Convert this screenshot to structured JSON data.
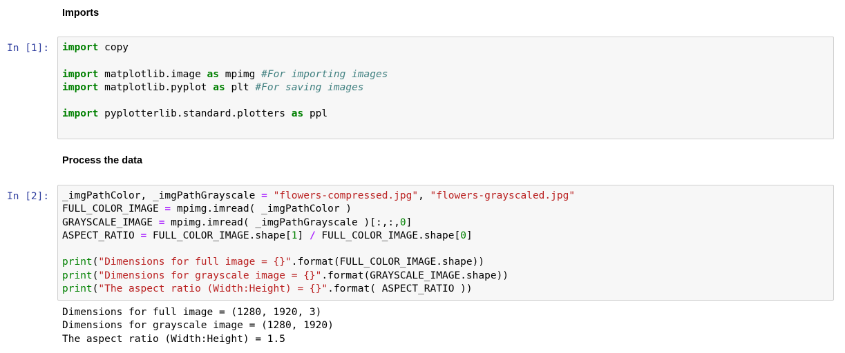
{
  "cells": [
    {
      "type": "markdown",
      "text": "Imports"
    },
    {
      "type": "code",
      "prompt": "In [1]:",
      "lines": [
        [
          {
            "t": "kw",
            "v": "import"
          },
          {
            "t": "",
            "v": " copy"
          }
        ],
        [],
        [
          {
            "t": "kw",
            "v": "import"
          },
          {
            "t": "",
            "v": " matplotlib.image "
          },
          {
            "t": "kw",
            "v": "as"
          },
          {
            "t": "",
            "v": " mpimg "
          },
          {
            "t": "cm",
            "v": "#For importing images"
          }
        ],
        [
          {
            "t": "kw",
            "v": "import"
          },
          {
            "t": "",
            "v": " matplotlib.pyplot "
          },
          {
            "t": "kw",
            "v": "as"
          },
          {
            "t": "",
            "v": " plt "
          },
          {
            "t": "cm",
            "v": "#For saving images"
          }
        ],
        [],
        [
          {
            "t": "kw",
            "v": "import"
          },
          {
            "t": "",
            "v": " pyplotterlib.standard.plotters "
          },
          {
            "t": "kw",
            "v": "as"
          },
          {
            "t": "",
            "v": " ppl"
          }
        ]
      ]
    },
    {
      "type": "markdown",
      "text": "Process the data"
    },
    {
      "type": "code",
      "prompt": "In [2]:",
      "lines": [
        [
          {
            "t": "",
            "v": "_imgPathColor, _imgPathGrayscale "
          },
          {
            "t": "op",
            "v": "="
          },
          {
            "t": "",
            "v": " "
          },
          {
            "t": "str",
            "v": "\"flowers-compressed.jpg\""
          },
          {
            "t": "",
            "v": ", "
          },
          {
            "t": "str",
            "v": "\"flowers-grayscaled.jpg\""
          }
        ],
        [
          {
            "t": "",
            "v": "FULL_COLOR_IMAGE "
          },
          {
            "t": "op",
            "v": "="
          },
          {
            "t": "",
            "v": " mpimg.imread( _imgPathColor )"
          }
        ],
        [
          {
            "t": "",
            "v": "GRAYSCALE_IMAGE "
          },
          {
            "t": "op",
            "v": "="
          },
          {
            "t": "",
            "v": " mpimg.imread( _imgPathGrayscale )[:,:,"
          },
          {
            "t": "num",
            "v": "0"
          },
          {
            "t": "",
            "v": "]"
          }
        ],
        [
          {
            "t": "",
            "v": "ASPECT_RATIO "
          },
          {
            "t": "op",
            "v": "="
          },
          {
            "t": "",
            "v": " FULL_COLOR_IMAGE.shape["
          },
          {
            "t": "num",
            "v": "1"
          },
          {
            "t": "",
            "v": "] "
          },
          {
            "t": "op",
            "v": "/"
          },
          {
            "t": "",
            "v": " FULL_COLOR_IMAGE.shape["
          },
          {
            "t": "num",
            "v": "0"
          },
          {
            "t": "",
            "v": "]"
          }
        ],
        [],
        [
          {
            "t": "bi",
            "v": "print"
          },
          {
            "t": "",
            "v": "("
          },
          {
            "t": "str",
            "v": "\"Dimensions for full image = {}\""
          },
          {
            "t": "",
            "v": ".format(FULL_COLOR_IMAGE.shape))"
          }
        ],
        [
          {
            "t": "bi",
            "v": "print"
          },
          {
            "t": "",
            "v": "("
          },
          {
            "t": "str",
            "v": "\"Dimensions for grayscale image = {}\""
          },
          {
            "t": "",
            "v": ".format(GRAYSCALE_IMAGE.shape))"
          }
        ],
        [
          {
            "t": "bi",
            "v": "print"
          },
          {
            "t": "",
            "v": "("
          },
          {
            "t": "str",
            "v": "\"The aspect ratio (Width:Height) = {}\""
          },
          {
            "t": "",
            "v": ".format( ASPECT_RATIO ))"
          }
        ]
      ],
      "output": [
        "Dimensions for full image = (1280, 1920, 3)",
        "Dimensions for grayscale image = (1280, 1920)",
        "The aspect ratio (Width:Height) = 1.5"
      ]
    }
  ],
  "colors": {
    "prompt": "#303f9f",
    "keyword": "#008000",
    "comment": "#408080",
    "string": "#ba2121",
    "operator": "#aa22ff",
    "cell_background": "#f7f7f7",
    "cell_border": "#cfcfcf"
  }
}
